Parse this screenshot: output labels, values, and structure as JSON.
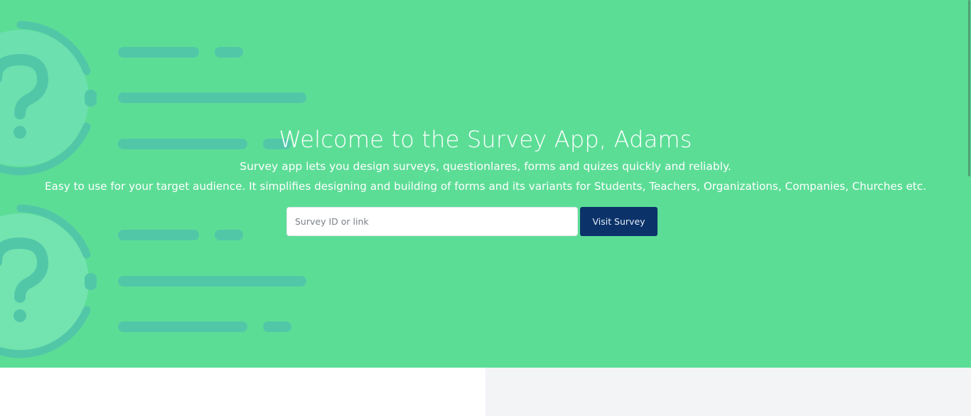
{
  "hero": {
    "title": "Welcome to the Survey App, Adams",
    "line1": "Survey app lets you design surveys, questionlares, forms and quizes quickly and reliably.",
    "line2": "Easy to use for your target audience. It simplifies designing and building of forms and its variants for Students, Teachers, Organizations, Companies, Churches etc.",
    "background_color": "#5cdd96",
    "illustration_icon": "question-list-illustration"
  },
  "search": {
    "placeholder": "Survey ID or link",
    "value": "",
    "button_label": "Visit Survey",
    "button_color": "#0b336a"
  },
  "colors": {
    "accent": "#5cdd96",
    "illustration": "#52c7a8",
    "primary_button": "#0b336a",
    "lower_panel": "#f3f4f6"
  }
}
